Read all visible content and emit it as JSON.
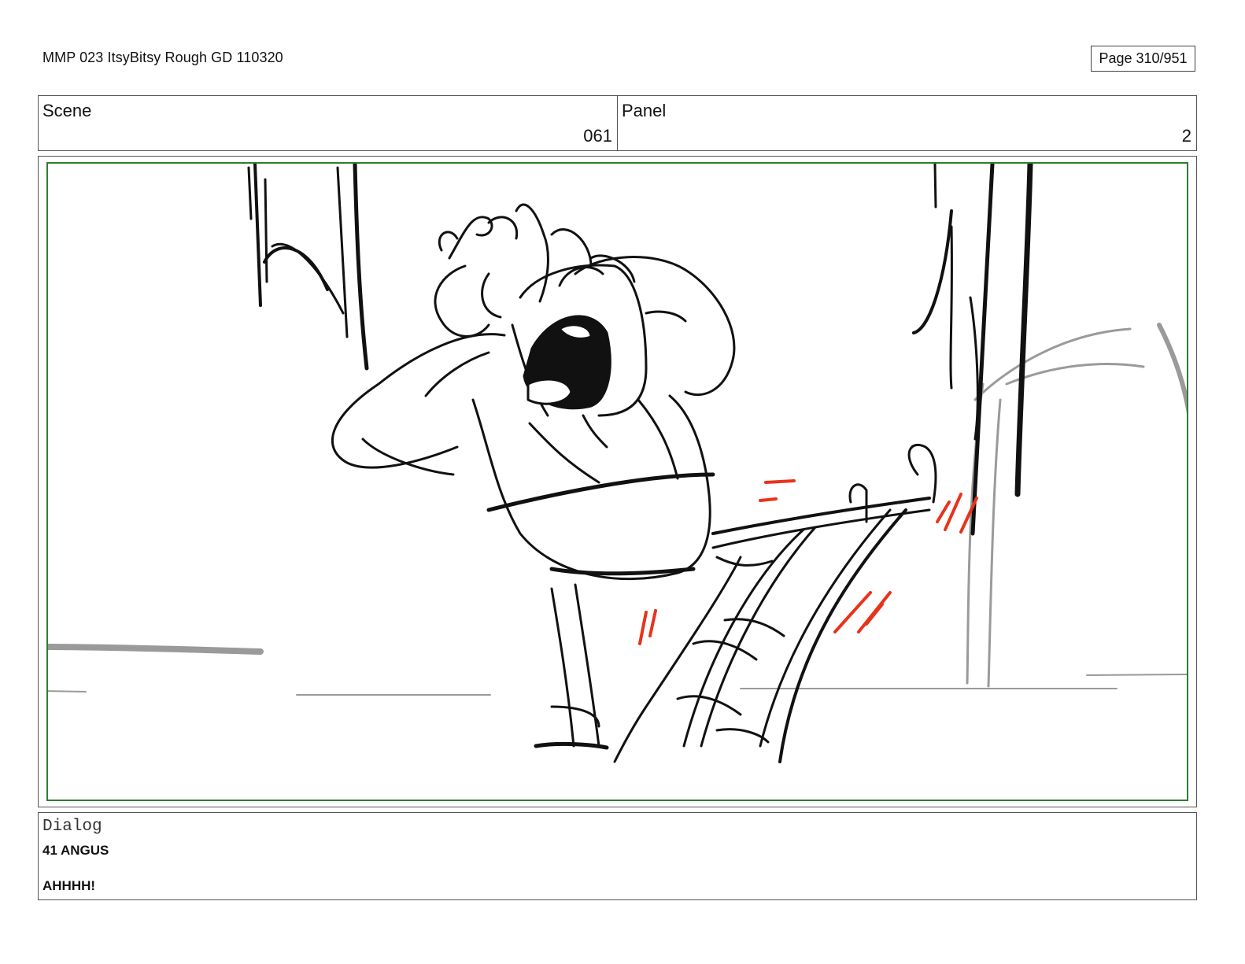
{
  "header": {
    "document_title": "MMP 023 ItsyBitsy Rough GD 110320",
    "page_label": "Page 310/951"
  },
  "meta": {
    "scene_label": "Scene",
    "scene_value": "061",
    "panel_label": "Panel",
    "panel_value": "2"
  },
  "dialog": {
    "heading": "Dialog",
    "speaker": "41 ANGUS",
    "line": "AHHHH!"
  },
  "colors": {
    "panel_border": "#2f7d2f",
    "motion_marks": "#e8331c",
    "background_lines": "#9a9a9a",
    "ink": "#111111"
  }
}
